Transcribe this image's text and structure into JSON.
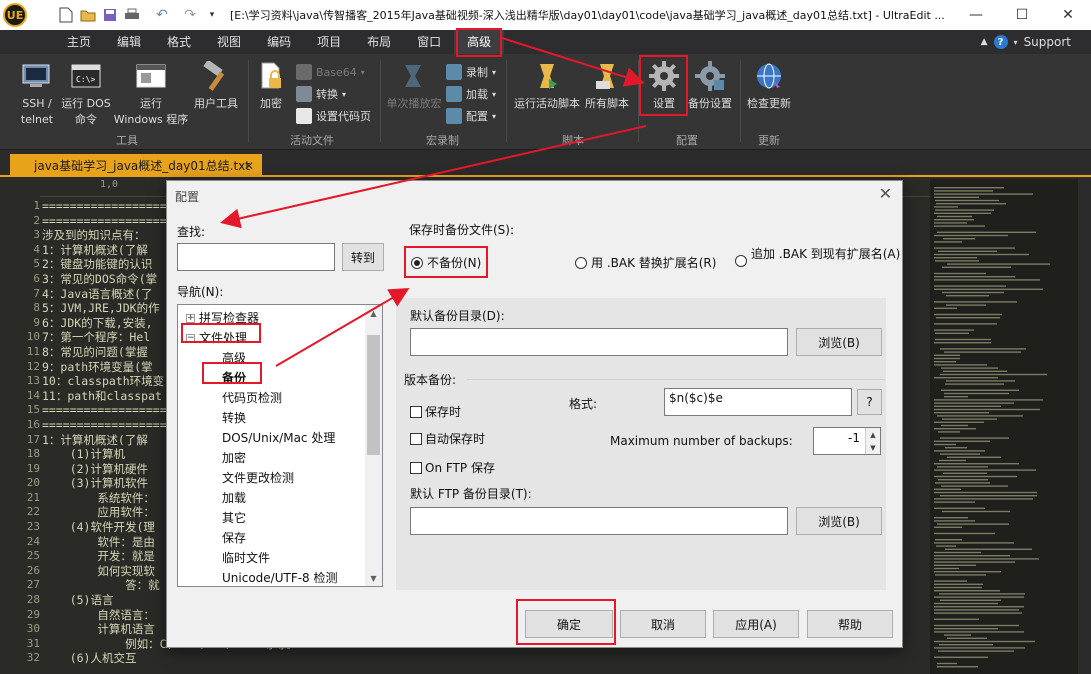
{
  "app": {
    "title": "[E:\\学习资料\\java\\传智播客_2015年Java基础视频-深入浅出精华版\\day01\\day01\\code\\java基础学习_java概述_day01总结.txt] - UltraEdit ...",
    "logo_text": "UE"
  },
  "menu": {
    "items": [
      "主页",
      "编辑",
      "格式",
      "视图",
      "编码",
      "项目",
      "布局",
      "窗口",
      "高级"
    ],
    "support": "Support"
  },
  "ribbon": {
    "ssh": "SSH /\ntelnet",
    "run_dos": "运行 DOS\n命令",
    "run_windows": "运行\nWindows 程序",
    "user_tools": "用户工具",
    "tools_group": "工具",
    "encrypt": "加密",
    "base64": "Base64",
    "convert": "转换",
    "set_codepage": "设置代码页",
    "run_file_group": "活动文件",
    "single_play": "单次播放宏",
    "record": "录制",
    "load": "加载",
    "config": "配置",
    "macro_group": "宏录制",
    "run_active_script": "运行活动脚本",
    "all_scripts": "所有脚本",
    "script_group": "脚本",
    "settings": "设置",
    "backup_settings": "备份设置",
    "config_group": "配置",
    "check_update": "检查更新",
    "update_group": "更新"
  },
  "tab": {
    "label": "java基础学习_java概述_day01总结.txt"
  },
  "editor": {
    "ruler": "1,0",
    "line_numbers": [
      "1",
      "2",
      "3",
      "4",
      "5",
      "6",
      "7",
      "8",
      "9",
      "10",
      "11",
      "12",
      "13",
      "14",
      "15",
      "16",
      "17",
      "18",
      "19",
      "20",
      "21",
      "22",
      "23",
      "24",
      "25",
      "26",
      "27",
      "28",
      "29",
      "30",
      "31",
      "32"
    ],
    "lines": [
      "=========================================",
      "=========================================",
      "涉及到的知识点有：",
      "1：计算机概述(了解",
      "2：键盘功能键的认识",
      "3：常见的DOS命令(掌",
      "4：Java语言概述(了",
      "5：JVM,JRE,JDK的作",
      "6：JDK的下载,安装,",
      "7：第一个程序：Hel",
      "8：常见的问题(掌握",
      "9：path环境变量(掌",
      "10：classpath环境变",
      "11：path和classpat",
      "=========================================",
      "=========================================",
      "1：计算机概述(了解",
      "    (1)计算机",
      "    (2)计算机硬件",
      "    (3)计算机软件",
      "        系统软件：",
      "        应用软件：",
      "    (4)软件开发(理",
      "        软件：是由",
      "        开发：就是",
      "        如何实现软",
      "            答：就",
      "    (5)语言",
      "        自然语言：",
      "        计算机语言",
      "            例如：C、C++、C#、Java等等。",
      "    (6)人机交互"
    ]
  },
  "dialog": {
    "title": "配置",
    "search_label": "查找:",
    "search_value": "",
    "goto_button": "转到",
    "nav_label": "导航(N):",
    "tree": [
      {
        "label": "拼写检查器",
        "expander": "+"
      },
      {
        "label": "文件处理",
        "expander": "−"
      },
      {
        "label": "高级"
      },
      {
        "label": "备份"
      },
      {
        "label": "代码页检测"
      },
      {
        "label": "转换"
      },
      {
        "label": "DOS/Unix/Mac 处理"
      },
      {
        "label": "加密"
      },
      {
        "label": "文件更改检测"
      },
      {
        "label": "加载"
      },
      {
        "label": "其它"
      },
      {
        "label": "保存"
      },
      {
        "label": "临时文件"
      },
      {
        "label": "Unicode/UTF-8 检测"
      }
    ],
    "backup_on_save_label": "保存时备份文件(S):",
    "radio_no_backup": "不备份(N)",
    "radio_replace_bak": "用 .BAK 替换扩展名(R)",
    "radio_append_bak": "追加 .BAK 到现有扩展名(A)",
    "default_dir_label": "默认备份目录(D):",
    "default_dir_value": "",
    "browse": "浏览(B)",
    "versioned_label": "版本备份:",
    "on_save": "保存时",
    "autosave": "自动保存时",
    "on_ftp": "On FTP 保存",
    "format_label": "格式:",
    "format_value": "$n($c)$e",
    "format_help": "?",
    "max_backups_label": "Maximum number of backups:",
    "max_backups_value": "-1",
    "ftp_dir_label": "默认 FTP 备份目录(T):",
    "ftp_dir_value": "",
    "browse2": "浏览(B)",
    "ok": "确定",
    "cancel": "取消",
    "apply": "应用(A)",
    "help": "帮助"
  },
  "colors": {
    "accent": "#e8a31b",
    "highlight": "#e3182a",
    "menubar": "#2d2d30",
    "ribbon": "#353535"
  }
}
